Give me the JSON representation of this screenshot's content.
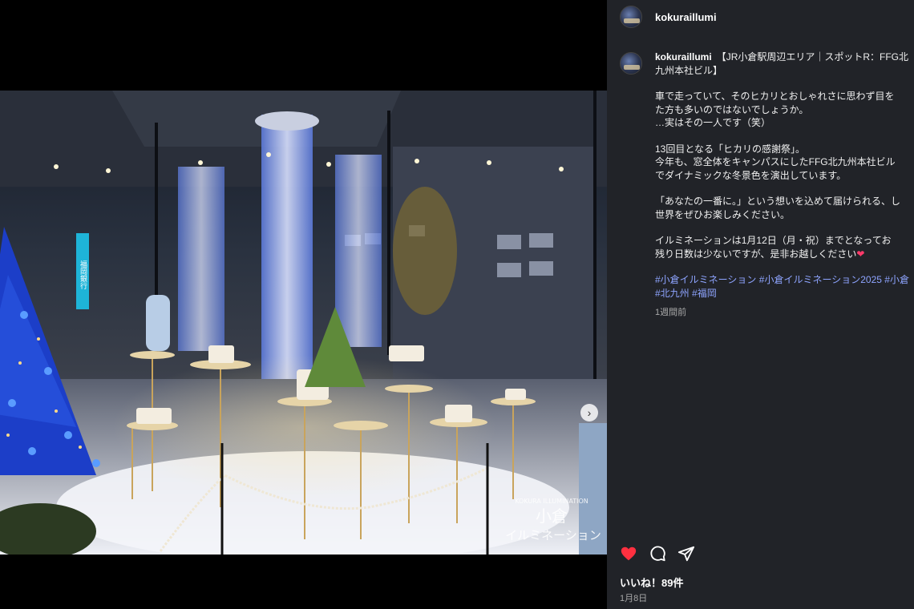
{
  "post": {
    "username": "kokuraillumi",
    "likes_label": "いいね！89件",
    "date_label": "1月8日",
    "image_dots": 2,
    "active_dot": 0,
    "caption": {
      "first_line": "【JR小倉駅周辺エリア｜スポットR：FFG北九州本社ビル】",
      "paragraphs": [
        "車で走っていて、そのヒカリとおしゃれさに思わず目を\nた方も多いのではないでしょうか。\n…実はその一人です（笑）",
        "13回目となる「ヒカリの感謝祭」。\n今年も、窓全体をキャンパスにしたFFG北九州本社ビル\nでダイナミックな冬景色を演出しています。",
        "「あなたの一番に。」という想いを込めて届けられる、し\n世界をぜひお楽しみください。",
        "イルミネーションは1月12日（月・祝）までとなってお\n残り日数は少ないですが、是非お越しください"
      ],
      "heart_emoji": "❤",
      "hashtags": [
        "#小倉イルミネーション",
        "#小倉イルミネーション2025",
        "#小倉",
        "#北九州",
        "#福岡"
      ],
      "time_ago": "1週間前"
    }
  },
  "media": {
    "next_button_glyph": "›",
    "watermark_line1": "KOKURA ILLUMINATION",
    "watermark_line2": "小倉",
    "watermark_line3": "イルミネーション",
    "bank_sign": "福岡銀行"
  },
  "icons": {
    "heart": "heart-icon",
    "comment": "comment-icon",
    "share": "send-icon",
    "like_color": "#ff3040"
  }
}
